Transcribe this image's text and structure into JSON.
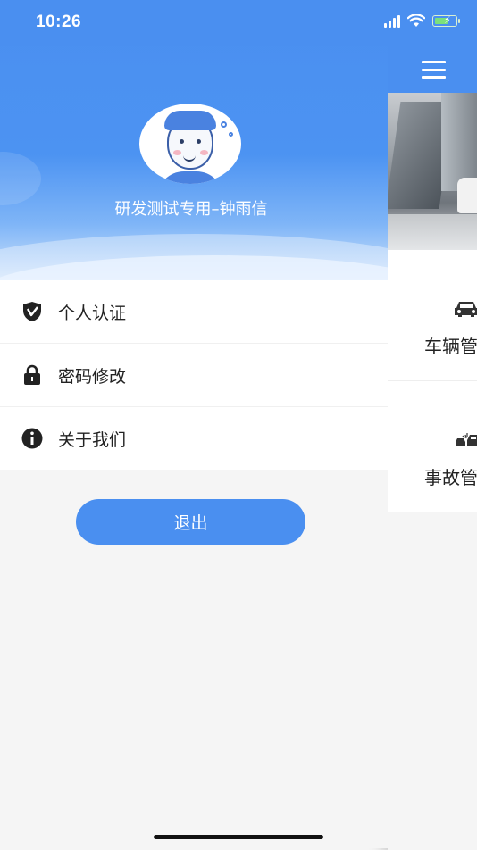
{
  "status_bar": {
    "time": "10:26"
  },
  "drawer": {
    "username": "研发测试专用–钟雨信",
    "menu": [
      {
        "label": "个人认证",
        "icon": "shield-check-icon"
      },
      {
        "label": "密码修改",
        "icon": "lock-icon"
      },
      {
        "label": "关于我们",
        "icon": "info-icon"
      }
    ],
    "logout_label": "退出"
  },
  "main": {
    "cards": [
      {
        "label": "车辆管",
        "icon": "car-icon"
      },
      {
        "label": "事故管",
        "icon": "car-crash-icon"
      }
    ]
  },
  "colors": {
    "brand": "#4a8ff0",
    "background": "#f5f5f5"
  }
}
